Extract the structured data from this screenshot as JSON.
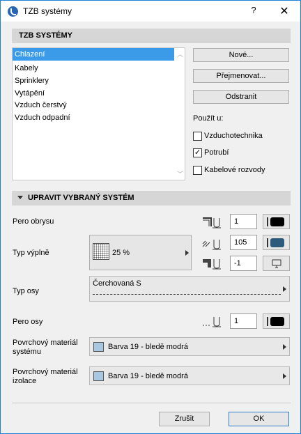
{
  "window": {
    "title": "TZB systémy",
    "help": "?",
    "close": "✕"
  },
  "section1": {
    "title": "TZB SYSTÉMY"
  },
  "systems": [
    "Chlazení",
    "Kabely",
    "Sprinklery",
    "Vytápění",
    "Vzduch čerstvý",
    "Vzduch odpadní"
  ],
  "buttons": {
    "new": "Nové...",
    "rename": "Přejmenovat...",
    "remove": "Odstranit"
  },
  "use_in": {
    "label": "Použít u:",
    "items": [
      {
        "label": "Vzduchotechnika",
        "checked": false,
        "mark": ""
      },
      {
        "label": "Potrubí",
        "checked": true,
        "mark": "✓"
      },
      {
        "label": "Kabelové rozvody",
        "checked": false,
        "mark": ""
      }
    ]
  },
  "section2": {
    "title": "UPRAVIT VYBRANÝ SYSTÉM"
  },
  "contour_pen": {
    "label": "Pero obrysu",
    "value": "1",
    "color": "#000000"
  },
  "fill_type": {
    "label": "Typ výplně",
    "value": "25 %"
  },
  "fill_pen": {
    "value": "105",
    "color": "#2d5a7a"
  },
  "bg_pen": {
    "value": "-1"
  },
  "axis_type": {
    "label": "Typ osy",
    "value": "Čerchovaná S"
  },
  "axis_pen": {
    "label": "Pero osy",
    "value": "1",
    "color": "#000000"
  },
  "system_material": {
    "label_line1": "Povrchový materiál",
    "label_line2": "systému",
    "value": "Barva 19 - bledě modrá",
    "color": "#a9c8df"
  },
  "insulation_material": {
    "label_line1": "Povrchový materiál",
    "label_line2": "izolace",
    "value": "Barva 19 - bledě modrá",
    "color": "#a9c8df"
  },
  "footer": {
    "cancel": "Zrušit",
    "ok": "OK"
  }
}
